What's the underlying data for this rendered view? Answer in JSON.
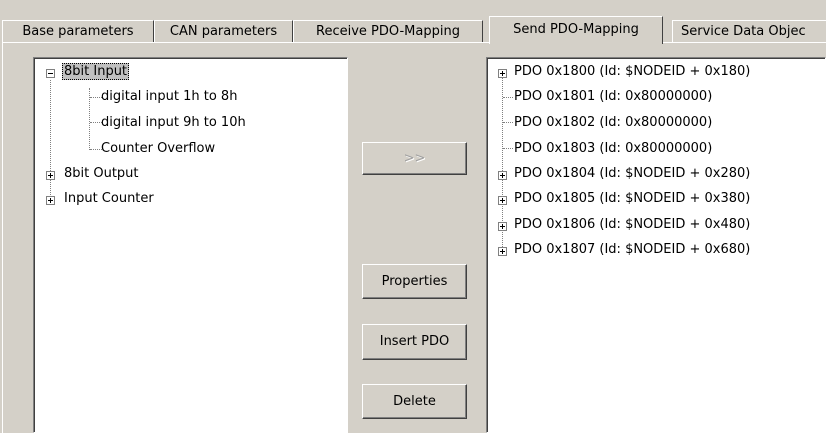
{
  "tabs": [
    {
      "label": "Base parameters"
    },
    {
      "label": "CAN parameters"
    },
    {
      "label": "Receive PDO-Mapping"
    },
    {
      "label": "Send PDO-Mapping"
    },
    {
      "label": "Service Data Objec"
    }
  ],
  "left_tree": {
    "nodes": [
      {
        "label": "8bit Input"
      },
      {
        "label": "digital input 1h to 8h"
      },
      {
        "label": "digital input 9h to 10h"
      },
      {
        "label": "Counter Overflow"
      },
      {
        "label": "8bit Output"
      },
      {
        "label": "Input Counter"
      }
    ]
  },
  "buttons": {
    "move_label": ">>",
    "properties_label": "Properties",
    "insert_pdo_label": "Insert PDO",
    "delete_label": "Delete"
  },
  "right_tree": {
    "nodes": [
      {
        "label": "PDO 0x1800 (Id: $NODEID + 0x180)"
      },
      {
        "label": "PDO 0x1801 (Id: 0x80000000)"
      },
      {
        "label": "PDO 0x1802 (Id: 0x80000000)"
      },
      {
        "label": "PDO 0x1803 (Id: 0x80000000)"
      },
      {
        "label": "PDO 0x1804 (Id: $NODEID + 0x280)"
      },
      {
        "label": "PDO 0x1805 (Id: $NODEID + 0x380)"
      },
      {
        "label": "PDO 0x1806 (Id: $NODEID + 0x480)"
      },
      {
        "label": "PDO 0x1807 (Id: $NODEID + 0x680)"
      }
    ]
  }
}
